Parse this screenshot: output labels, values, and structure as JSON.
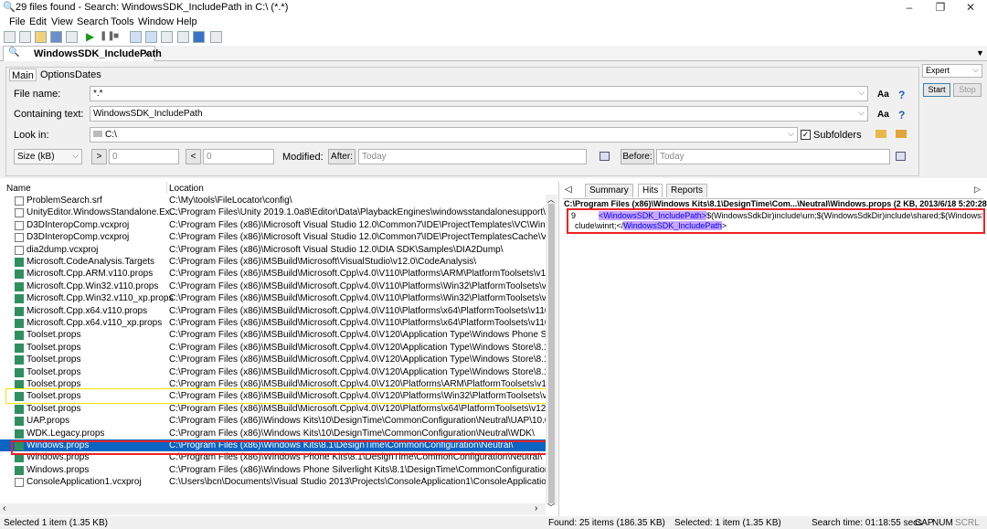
{
  "window": {
    "title": "29 files found - Search: WindowsSDK_IncludePath in C:\\ (*.*)",
    "minimize": "–",
    "maximize": "❐",
    "close": "✕"
  },
  "menu": [
    "File",
    "Edit",
    "View",
    "Search",
    "Tools",
    "Window",
    "Help"
  ],
  "doc_tab": {
    "label": "WindowsSDK_IncludePath",
    "close": "x"
  },
  "form": {
    "tabs": [
      "Main",
      "Options",
      "Dates"
    ],
    "file_name_label": "File name:",
    "file_name_value": "*.*",
    "containing_label": "Containing text:",
    "containing_value": "WindowsSDK_IncludePath",
    "look_in_label": "Look in:",
    "look_in_value": "C:\\",
    "subfolders_label": "Subfolders",
    "size_select": "Size (kB)",
    "size_gt": ">",
    "size_min": "0",
    "size_lt": "<",
    "size_max": "0",
    "modified_label": "Modified:",
    "after_label": "After:",
    "after_value": "Today",
    "before_label": "Before:",
    "before_value": "Today",
    "aa": "Aa",
    "help": "?",
    "mode": "Expert",
    "start": "Start",
    "stop": "Stop"
  },
  "list": {
    "col_name": "Name",
    "col_location": "Location",
    "rows": [
      {
        "name": "ProblemSearch.srf",
        "location": "C:\\My\\tools\\FileLocator\\config\\"
      },
      {
        "name": "UnityEditor.WindowsStandalone.Ex...",
        "location": "C:\\Program Files\\Unity 2019.1.0a8\\Editor\\Data\\PlaybackEngines\\windowsstandalonesupport\\"
      },
      {
        "name": "D3DInteropComp.vcxproj",
        "location": "C:\\Program Files (x86)\\Microsoft Visual Studio 12.0\\Common7\\IDE\\ProjectTemplates\\VC\\Windows Ph"
      },
      {
        "name": "D3DInteropComp.vcxproj",
        "location": "C:\\Program Files (x86)\\Microsoft Visual Studio 12.0\\Common7\\IDE\\ProjectTemplatesCache\\VC\\Windo"
      },
      {
        "name": "dia2dump.vcxproj",
        "location": "C:\\Program Files (x86)\\Microsoft Visual Studio 12.0\\DIA SDK\\Samples\\DIA2Dump\\"
      },
      {
        "name": "Microsoft.CodeAnalysis.Targets",
        "location": "C:\\Program Files (x86)\\MSBuild\\Microsoft\\VisualStudio\\v12.0\\CodeAnalysis\\"
      },
      {
        "name": "Microsoft.Cpp.ARM.v110.props",
        "location": "C:\\Program Files (x86)\\MSBuild\\Microsoft.Cpp\\v4.0\\V110\\Platforms\\ARM\\PlatformToolsets\\v110\\"
      },
      {
        "name": "Microsoft.Cpp.Win32.v110.props",
        "location": "C:\\Program Files (x86)\\MSBuild\\Microsoft.Cpp\\v4.0\\V110\\Platforms\\Win32\\PlatformToolsets\\v110\\"
      },
      {
        "name": "Microsoft.Cpp.Win32.v110_xp.props",
        "location": "C:\\Program Files (x86)\\MSBuild\\Microsoft.Cpp\\v4.0\\V110\\Platforms\\Win32\\PlatformToolsets\\v110_xp"
      },
      {
        "name": "Microsoft.Cpp.x64.v110.props",
        "location": "C:\\Program Files (x86)\\MSBuild\\Microsoft.Cpp\\v4.0\\V110\\Platforms\\x64\\PlatformToolsets\\v110\\"
      },
      {
        "name": "Microsoft.Cpp.x64.v110_xp.props",
        "location": "C:\\Program Files (x86)\\MSBuild\\Microsoft.Cpp\\v4.0\\V110\\Platforms\\x64\\PlatformToolsets\\v110_xp\\"
      },
      {
        "name": "Toolset.props",
        "location": "C:\\Program Files (x86)\\MSBuild\\Microsoft.Cpp\\v4.0\\V120\\Application Type\\Windows Phone Silverligh"
      },
      {
        "name": "Toolset.props",
        "location": "C:\\Program Files (x86)\\MSBuild\\Microsoft.Cpp\\v4.0\\V120\\Application Type\\Windows Store\\8.1\\Platfo"
      },
      {
        "name": "Toolset.props",
        "location": "C:\\Program Files (x86)\\MSBuild\\Microsoft.Cpp\\v4.0\\V120\\Application Type\\Windows Store\\8.1\\Platfo"
      },
      {
        "name": "Toolset.props",
        "location": "C:\\Program Files (x86)\\MSBuild\\Microsoft.Cpp\\v4.0\\V120\\Application Type\\Windows Store\\8.1\\Platfo"
      },
      {
        "name": "Toolset.props",
        "location": "C:\\Program Files (x86)\\MSBuild\\Microsoft.Cpp\\v4.0\\V120\\Platforms\\ARM\\PlatformToolsets\\v120\\"
      },
      {
        "name": "Toolset.props",
        "location": "C:\\Program Files (x86)\\MSBuild\\Microsoft.Cpp\\v4.0\\V120\\Platforms\\Win32\\PlatformToolsets\\v120\\"
      },
      {
        "name": "Toolset.props",
        "location": "C:\\Program Files (x86)\\MSBuild\\Microsoft.Cpp\\v4.0\\V120\\Platforms\\x64\\PlatformToolsets\\v120\\"
      },
      {
        "name": "UAP.props",
        "location": "C:\\Program Files (x86)\\Windows Kits\\10\\DesignTime\\CommonConfiguration\\Neutral\\UAP\\10.0.18362"
      },
      {
        "name": "WDK.Legacy.props",
        "location": "C:\\Program Files (x86)\\Windows Kits\\10\\DesignTime\\CommonConfiguration\\Neutral\\WDK\\"
      },
      {
        "name": "Windows.props",
        "location": "C:\\Program Files (x86)\\Windows Kits\\8.1\\DesignTime\\CommonConfiguration\\Neutral\\"
      },
      {
        "name": "Windows.props",
        "location": "C:\\Program Files (x86)\\Windows Phone Kits\\8.1\\DesignTime\\CommonConfiguration\\Neutral\\"
      },
      {
        "name": "Windows.props",
        "location": "C:\\Program Files (x86)\\Windows Phone Silverlight Kits\\8.1\\DesignTime\\CommonConfiguration\\Neutra"
      },
      {
        "name": "ConsoleApplication1.vcxproj",
        "location": "C:\\Users\\bcn\\Documents\\Visual Studio 2013\\Projects\\ConsoleApplication1\\ConsoleApplication1\\"
      }
    ]
  },
  "right": {
    "tabs": [
      "Summary",
      "Hits",
      "Reports"
    ],
    "header": "C:\\Program Files (x86)\\Windows Kits\\8.1\\DesignTime\\Com...\\Neutral\\Windows.props   (2 KB,  2013/6/18 5:20:28)",
    "hit_line": "9",
    "hit_tag_open": "<WindowsSDK_IncludePath>",
    "hit_text_1": "$(WindowsSdkDir)include\\um;$(WindowsSdkDir)include\\shared;$(WindowsSdkDir)in",
    "hit_text_2": "clude\\winrt;</",
    "hit_tag_close": "WindowsSDK_IncludePath",
    "hit_end": ">"
  },
  "status": {
    "left": "Selected 1 item (1.35 KB)",
    "found": "Found: 25 items (186.35 KB)",
    "selected": "Selected: 1 item (1.35 KB)",
    "time": "Search time: 01:18:55 secs",
    "caps": "CAP",
    "num": "NUM",
    "scrl": "SCRL"
  }
}
